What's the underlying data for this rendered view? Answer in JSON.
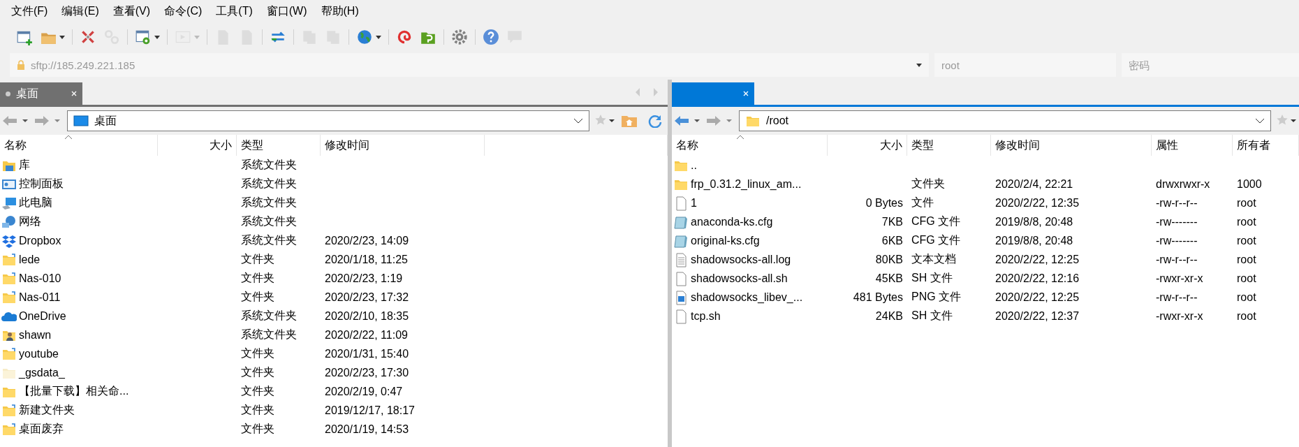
{
  "menu": [
    "文件(F)",
    "编辑(E)",
    "查看(V)",
    "命令(C)",
    "工具(T)",
    "窗口(W)",
    "帮助(H)"
  ],
  "toolbar": [
    [
      {
        "kind": "new-window",
        "disabled": false,
        "dropdown": false
      },
      {
        "kind": "folder",
        "disabled": false,
        "dropdown": true
      }
    ],
    [
      {
        "kind": "disconnect",
        "disabled": false,
        "dropdown": false
      },
      {
        "kind": "link",
        "disabled": true,
        "dropdown": false
      }
    ],
    [
      {
        "kind": "window-gear",
        "disabled": false,
        "dropdown": true
      }
    ],
    [
      {
        "kind": "console",
        "disabled": true,
        "dropdown": true
      }
    ],
    [
      {
        "kind": "document",
        "disabled": true,
        "dropdown": false
      },
      {
        "kind": "document",
        "disabled": true,
        "dropdown": false
      }
    ],
    [
      {
        "kind": "sync",
        "disabled": false,
        "dropdown": false
      }
    ],
    [
      {
        "kind": "copy",
        "disabled": true,
        "dropdown": false
      },
      {
        "kind": "copy",
        "disabled": true,
        "dropdown": false
      }
    ],
    [
      {
        "kind": "globe",
        "disabled": false,
        "dropdown": true
      }
    ],
    [
      {
        "kind": "swirl",
        "disabled": false,
        "dropdown": false
      },
      {
        "kind": "green-folder",
        "disabled": false,
        "dropdown": false
      }
    ],
    [
      {
        "kind": "gear",
        "disabled": false,
        "dropdown": false
      }
    ],
    [
      {
        "kind": "help",
        "disabled": false,
        "dropdown": false
      },
      {
        "kind": "chat",
        "disabled": true,
        "dropdown": false
      }
    ]
  ],
  "connection": {
    "host": "sftp://185.249.221.185",
    "user": "root",
    "password_placeholder": "密码"
  },
  "panels": [
    {
      "tab": {
        "label": "桌面",
        "selected": false
      },
      "back_enabled": false,
      "path": {
        "kind": "desktop",
        "text": "桌面"
      },
      "columns": [
        "名称",
        "大小",
        "类型",
        "修改时间"
      ],
      "rows": [
        {
          "kind": "library",
          "name": "库",
          "type": "系统文件夹"
        },
        {
          "kind": "control-panel",
          "name": "控制面板",
          "type": "系统文件夹"
        },
        {
          "kind": "computer",
          "name": "此电脑",
          "type": "系统文件夹"
        },
        {
          "kind": "network",
          "name": "网络",
          "type": "系统文件夹"
        },
        {
          "kind": "dropbox",
          "name": "Dropbox",
          "type": "系统文件夹",
          "date": "2020/2/23, 14:09"
        },
        {
          "kind": "shortcut",
          "name": "lede",
          "type": "文件夹",
          "date": "2020/1/18, 11:25"
        },
        {
          "kind": "shortcut",
          "name": "Nas-010",
          "type": "文件夹",
          "date": "2020/2/23, 1:19"
        },
        {
          "kind": "shortcut",
          "name": "Nas-011",
          "type": "文件夹",
          "date": "2020/2/23, 17:32"
        },
        {
          "kind": "cloud",
          "name": "OneDrive",
          "type": "系统文件夹",
          "date": "2020/2/10, 18:35"
        },
        {
          "kind": "user",
          "name": "shawn",
          "type": "系统文件夹",
          "date": "2020/2/22, 11:09"
        },
        {
          "kind": "shortcut",
          "name": "youtube",
          "type": "文件夹",
          "date": "2020/1/31, 15:40"
        },
        {
          "kind": "hidden",
          "name": "_gsdata_",
          "type": "文件夹",
          "date": "2020/2/23, 17:30"
        },
        {
          "kind": "folder",
          "name": "【批量下载】相关命...",
          "type": "文件夹",
          "date": "2020/2/19, 0:47"
        },
        {
          "kind": "shortcut",
          "name": "新建文件夹",
          "type": "文件夹",
          "date": "2019/12/17, 18:17"
        },
        {
          "kind": "shortcut",
          "name": "桌面废弃",
          "type": "文件夹",
          "date": "2020/1/19, 14:53"
        }
      ]
    },
    {
      "tab": {
        "selected": true
      },
      "back_enabled": true,
      "path": {
        "kind": "folder",
        "text": "/root"
      },
      "columns": [
        "名称",
        "大小",
        "类型",
        "修改时间",
        "属性",
        "所有者"
      ],
      "rows": [
        {
          "kind": "folder",
          "name": ".."
        },
        {
          "kind": "folder",
          "name": "frp_0.31.2_linux_am...",
          "type": "文件夹",
          "date": "2020/2/4, 22:21",
          "attrs": "drwxrwxr-x",
          "owner": "1000"
        },
        {
          "kind": "file",
          "name": "1",
          "size": "0 Bytes",
          "type": "文件",
          "date": "2020/2/22, 12:35",
          "attrs": "-rw-r--r--",
          "owner": "root"
        },
        {
          "kind": "cfg",
          "name": "anaconda-ks.cfg",
          "size": "7KB",
          "type": "CFG 文件",
          "date": "2019/8/8, 20:48",
          "attrs": "-rw-------",
          "owner": "root"
        },
        {
          "kind": "cfg",
          "name": "original-ks.cfg",
          "size": "6KB",
          "type": "CFG 文件",
          "date": "2019/8/8, 20:48",
          "attrs": "-rw-------",
          "owner": "root"
        },
        {
          "kind": "text",
          "name": "shadowsocks-all.log",
          "size": "80KB",
          "type": "文本文档",
          "date": "2020/2/22, 12:25",
          "attrs": "-rw-r--r--",
          "owner": "root"
        },
        {
          "kind": "file",
          "name": "shadowsocks-all.sh",
          "size": "45KB",
          "type": "SH 文件",
          "date": "2020/2/22, 12:16",
          "attrs": "-rwxr-xr-x",
          "owner": "root"
        },
        {
          "kind": "image",
          "name": "shadowsocks_libev_...",
          "size": "481 Bytes",
          "type": "PNG 文件",
          "date": "2020/2/22, 12:25",
          "attrs": "-rw-r--r--",
          "owner": "root"
        },
        {
          "kind": "file",
          "name": "tcp.sh",
          "size": "24KB",
          "type": "SH 文件",
          "date": "2020/2/22, 12:37",
          "attrs": "-rwxr-xr-x",
          "owner": "root"
        }
      ]
    }
  ]
}
